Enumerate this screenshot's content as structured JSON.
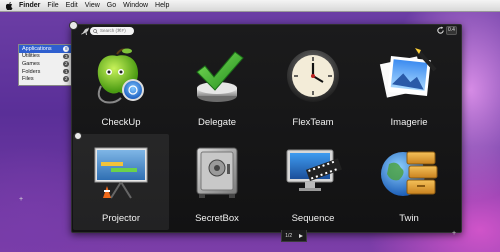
{
  "menubar": {
    "apple_icon": "apple-icon",
    "items": [
      {
        "label": "Finder",
        "bold": true
      },
      {
        "label": "File"
      },
      {
        "label": "Edit"
      },
      {
        "label": "View"
      },
      {
        "label": "Go"
      },
      {
        "label": "Window"
      },
      {
        "label": "Help"
      }
    ]
  },
  "search": {
    "placeholder": "Search (⌘F)"
  },
  "topright": {
    "zoom_label": "0.4"
  },
  "sidebar": {
    "items": [
      {
        "label": "Applications",
        "count": "8",
        "selected": true
      },
      {
        "label": "Utilities",
        "count": "3"
      },
      {
        "label": "Games",
        "count": "2"
      },
      {
        "label": "Folders",
        "count": "1"
      },
      {
        "label": "Files",
        "count": "2"
      }
    ],
    "add_label": "+"
  },
  "apps": [
    {
      "label": "CheckUp",
      "icon": "apple-stethoscope-icon"
    },
    {
      "label": "Delegate",
      "icon": "green-checkmark-icon"
    },
    {
      "label": "FlexTeam",
      "icon": "wall-clock-icon"
    },
    {
      "label": "Imagerie",
      "icon": "photo-stack-icon"
    },
    {
      "label": "Projector",
      "icon": "presentation-easel-icon"
    },
    {
      "label": "SecretBox",
      "icon": "safe-icon"
    },
    {
      "label": "Sequence",
      "icon": "film-monitor-icon"
    },
    {
      "label": "Twin",
      "icon": "globe-folders-icon"
    }
  ],
  "pager": {
    "label": "1/2"
  },
  "resize_label": "+",
  "colors": {
    "sidebar_selected": "#2f5fcf",
    "panel_bg": "#1b1b1c"
  }
}
